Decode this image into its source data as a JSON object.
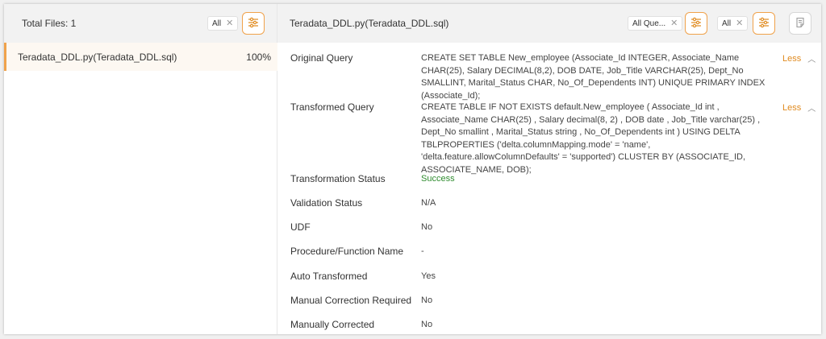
{
  "left_panel": {
    "total_files": "Total Files: 1",
    "filter_value": "All",
    "files": [
      {
        "name": "Teradata_DDL.py(Teradata_DDL.sql)",
        "percent": "100%"
      }
    ]
  },
  "right_panel": {
    "title": "Teradata_DDL.py(Teradata_DDL.sql)",
    "filter1_value": "All Que...",
    "filter2_value": "All",
    "less_label": "Less",
    "rows": [
      {
        "label": "Original Query",
        "value": "CREATE SET TABLE New_employee (Associate_Id INTEGER, Associate_Name CHAR(25), Salary DECIMAL(8,2), DOB DATE, Job_Title VARCHAR(25), Dept_No SMALLINT, Marital_Status CHAR, No_Of_Dependents INT) UNIQUE PRIMARY INDEX (Associate_Id);"
      },
      {
        "label": "Transformed Query",
        "value": "CREATE TABLE IF NOT EXISTS default.New_employee ( Associate_Id int , Associate_Name CHAR(25) , Salary decimal(8, 2) , DOB date , Job_Title varchar(25) , Dept_No smallint , Marital_Status string , No_Of_Dependents int ) USING DELTA TBLPROPERTIES ('delta.columnMapping.mode' = 'name', 'delta.feature.allowColumnDefaults' = 'supported') CLUSTER BY (ASSOCIATE_ID, ASSOCIATE_NAME, DOB);"
      },
      {
        "label": "Transformation Status",
        "value": "Success"
      },
      {
        "label": "Validation Status",
        "value": "N/A"
      },
      {
        "label": "UDF",
        "value": "No"
      },
      {
        "label": "Procedure/Function Name",
        "value": "-"
      },
      {
        "label": "Auto Transformed",
        "value": "Yes"
      },
      {
        "label": "Manual Correction Required",
        "value": "No"
      },
      {
        "label": "Manually Corrected",
        "value": "No"
      }
    ]
  },
  "colors": {
    "accent": "#f0a24b",
    "success": "#2e8b2e",
    "less_link": "#e08a1e"
  }
}
